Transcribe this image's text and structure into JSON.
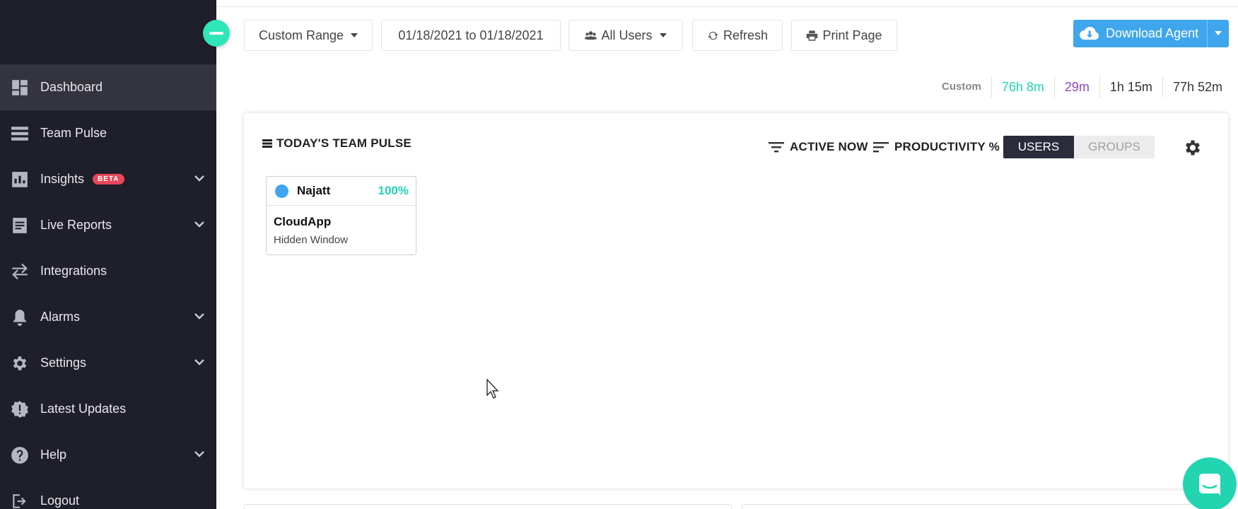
{
  "sidebar": {
    "items": [
      {
        "label": "Dashboard",
        "icon": "dashboard-icon",
        "active": true
      },
      {
        "label": "Team Pulse",
        "icon": "team-pulse-icon"
      },
      {
        "label": "Insights",
        "icon": "insights-icon",
        "badge": "BETA",
        "expandable": true
      },
      {
        "label": "Live Reports",
        "icon": "live-reports-icon",
        "expandable": true
      },
      {
        "label": "Integrations",
        "icon": "integrations-icon"
      },
      {
        "label": "Alarms",
        "icon": "bell-icon",
        "expandable": true
      },
      {
        "label": "Settings",
        "icon": "gear-icon",
        "expandable": true
      },
      {
        "label": "Latest Updates",
        "icon": "updates-icon"
      },
      {
        "label": "Help",
        "icon": "help-icon",
        "expandable": true
      },
      {
        "label": "Logout",
        "icon": "logout-icon"
      }
    ]
  },
  "toolbar": {
    "range_label": "Custom Range",
    "date_range": "01/18/2021 to 01/18/2021",
    "users_label": "All Users",
    "refresh_label": "Refresh",
    "print_label": "Print Page",
    "download_label": "Download Agent"
  },
  "time_summary": {
    "label": "Custom",
    "productive": "76h 8m",
    "unproductive": "29m",
    "neutral": "1h 15m",
    "total": "77h 52m"
  },
  "colors": {
    "accent_teal": "#1fd6b4",
    "accent_purple": "#8e44c9",
    "accent_blue": "#3fa6ee",
    "sidebar_bg": "#1f1f2b"
  },
  "pulse": {
    "title": "TODAY'S TEAM PULSE",
    "filter_active": "ACTIVE NOW",
    "filter_productivity": "PRODUCTIVITY %",
    "toggle_users": "USERS",
    "toggle_groups": "GROUPS",
    "users": [
      {
        "name": "Najatt",
        "percent": "100%",
        "app": "CloudApp",
        "window": "Hidden Window"
      }
    ]
  }
}
